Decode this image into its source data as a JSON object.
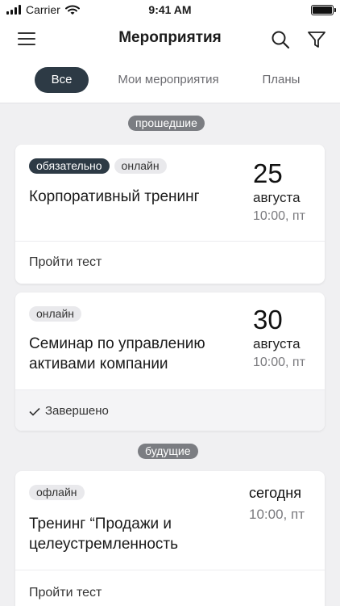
{
  "status_bar": {
    "carrier": "Carrier",
    "time": "9:41 AM"
  },
  "nav": {
    "title": "Мероприятия"
  },
  "tabs": [
    {
      "label": "Все",
      "active": true
    },
    {
      "label": "Мои мероприятия",
      "active": false
    },
    {
      "label": "Планы",
      "active": false
    }
  ],
  "sections": {
    "past": "прошедшие",
    "future": "будущие"
  },
  "events": [
    {
      "badges": [
        "обязательно",
        "онлайн"
      ],
      "title": "Корпоративный тренинг",
      "day": "25",
      "month": "августа",
      "time": "10:00, пт",
      "footer": "Пройти тест"
    },
    {
      "badges": [
        "онлайн"
      ],
      "title": "Семинар по управлению активами компании",
      "day": "30",
      "month": "августа",
      "time": "10:00, пт",
      "footer": "Завершено"
    },
    {
      "badges": [
        "офлайн"
      ],
      "title": "Тренинг “Продажи и целеустремленность",
      "day": "сегодня",
      "time": "10:00, пт",
      "footer": "Пройти тест"
    }
  ],
  "colors": {
    "accent_dark": "#2d3a45",
    "section_label": "#7b7d82",
    "background": "#f0f0f2"
  }
}
